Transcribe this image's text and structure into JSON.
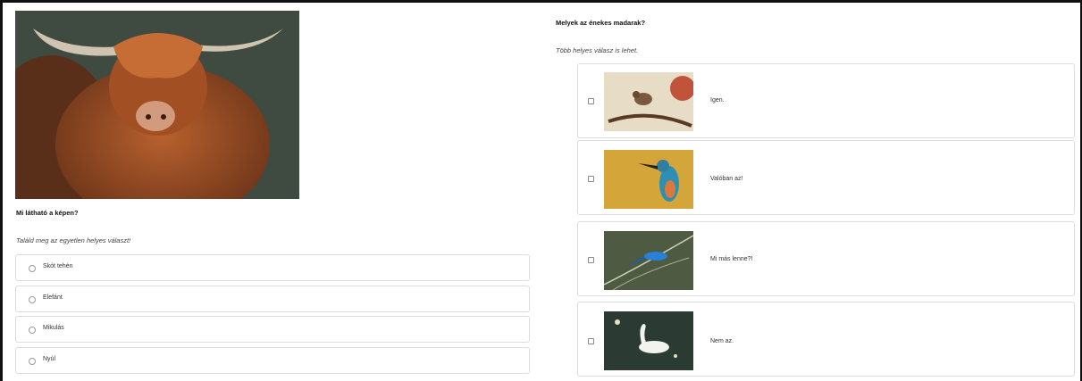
{
  "left_quiz": {
    "image_icon": "highland-cow-photo",
    "question": "Mi látható a képen?",
    "hint": "Találd meg az egyetlen helyes választ!",
    "options": [
      "Skót tehén",
      "Elefánt",
      "Mikulás",
      "Nyúl"
    ]
  },
  "right_quiz": {
    "question": "Melyek az énekes madarak?",
    "hint": "Több helyes válasz is lehet.",
    "options": [
      {
        "label": "Igen.",
        "image": "sparrow-photo"
      },
      {
        "label": "Valóban az!",
        "image": "kingfisher-photo"
      },
      {
        "label": "Mi más lenne?!",
        "image": "blue-bird-photo"
      },
      {
        "label": "Nem az.",
        "image": "swan-photo"
      }
    ]
  }
}
